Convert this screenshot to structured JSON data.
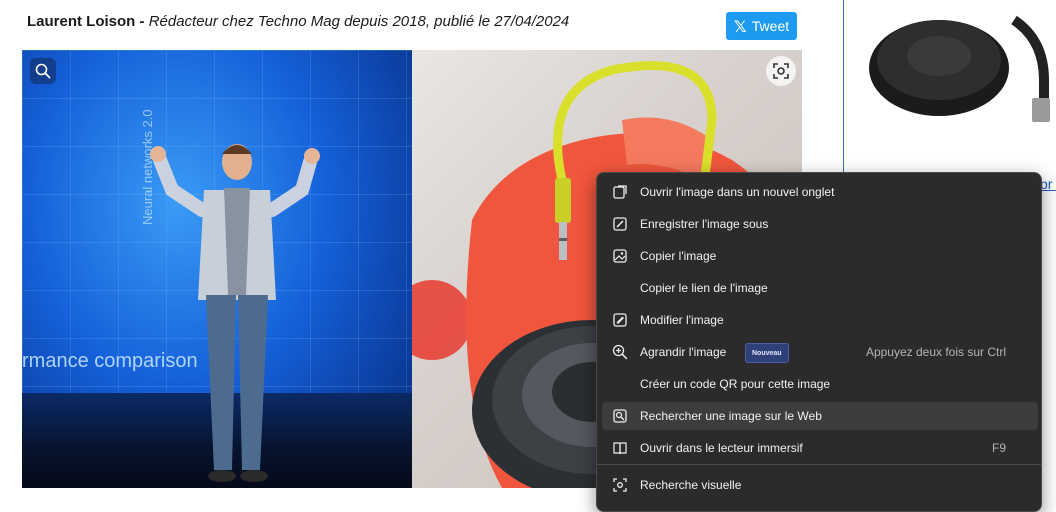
{
  "article": {
    "author": "Laurent Loison",
    "separator": " - ",
    "role": "Rédacteur chez Techno Mag depuis 2018, publié le 27/04/2024"
  },
  "share": {
    "tweet_label": "Tweet",
    "x_logo": "𝕏"
  },
  "photo_left": {
    "slide_text": "rmance comparison",
    "vertical_text": "Neural networks 2.0"
  },
  "ad": {
    "partial_link": "pr"
  },
  "context_menu": {
    "items": [
      {
        "label": "Ouvrir l'image dans un nouvel onglet",
        "icon": "new-tab-icon"
      },
      {
        "label": "Enregistrer l'image sous",
        "icon": "save-image-icon"
      },
      {
        "label": "Copier l'image",
        "icon": "copy-image-icon"
      },
      {
        "label": "Copier le lien de l'image",
        "icon": ""
      },
      {
        "label": "Modifier l'image",
        "icon": "edit-image-icon"
      },
      {
        "label": "Agrandir l'image",
        "icon": "zoom-in-icon",
        "badge": "Nouveau",
        "hint": "Appuyez deux fois sur Ctrl"
      },
      {
        "label": "Créer un code QR pour cette image",
        "icon": ""
      },
      {
        "label": "Rechercher une image sur le Web",
        "icon": "image-search-icon"
      },
      {
        "label": "Ouvrir dans le lecteur immersif",
        "icon": "immersive-reader-icon",
        "hint": "F9"
      },
      {
        "label": "Recherche visuelle",
        "icon": "visual-search-icon"
      }
    ]
  },
  "colors": {
    "tweet_bg": "#1d9bf0",
    "menu_bg": "#2b2b2b",
    "menu_hover": "#3d3d3d",
    "badge_bg": "#2f3f78"
  }
}
